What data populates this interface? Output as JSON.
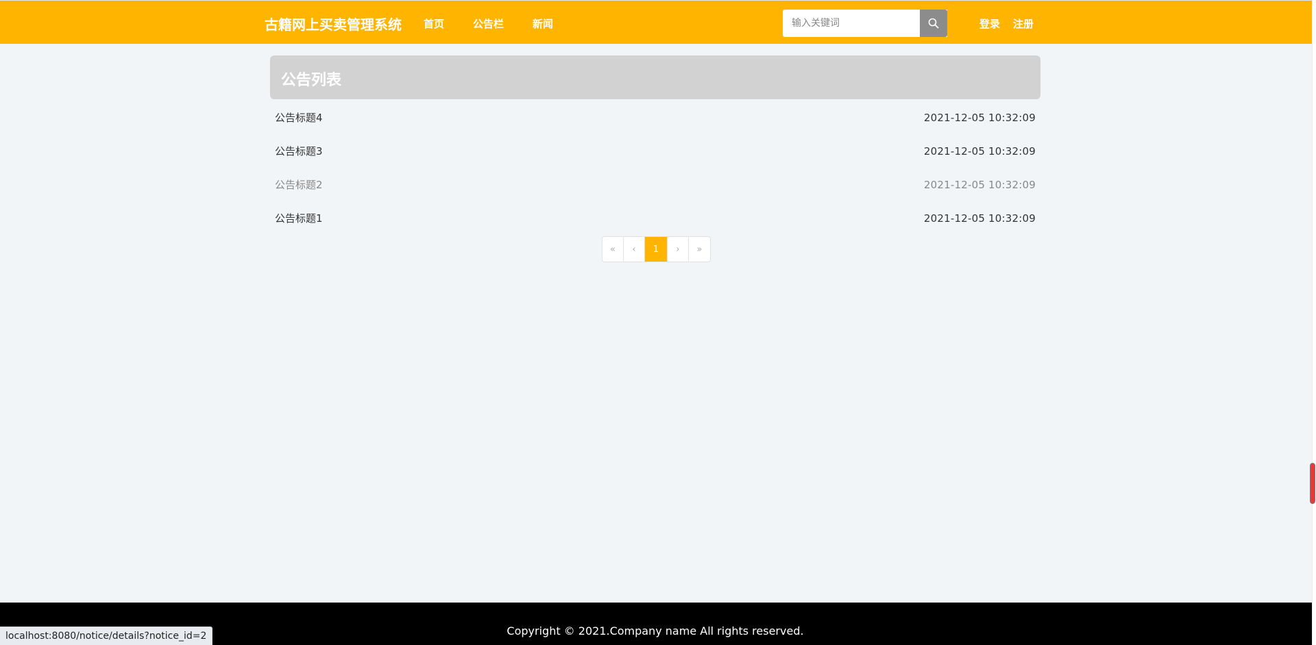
{
  "header": {
    "brand": "古籍网上买卖管理系统",
    "nav": [
      "首页",
      "公告栏",
      "新闻"
    ],
    "search_placeholder": "输入关键词",
    "login": "登录",
    "register": "注册"
  },
  "main": {
    "panel_title": "公告列表",
    "notices": [
      {
        "title": "公告标题4",
        "time": "2021-12-05 10:32:09"
      },
      {
        "title": "公告标题3",
        "time": "2021-12-05 10:32:09"
      },
      {
        "title": "公告标题2",
        "time": "2021-12-05 10:32:09"
      },
      {
        "title": "公告标题1",
        "time": "2021-12-05 10:32:09"
      }
    ],
    "pagination": {
      "first": "«",
      "prev": "‹",
      "current": "1",
      "next": "›",
      "last": "»"
    }
  },
  "footer": {
    "copyright": "Copyright © 2021.Company name All rights reserved."
  },
  "status_bar": {
    "url": "localhost:8080/notice/details?notice_id=2"
  },
  "colors": {
    "accent": "#ffb400",
    "footer_bg": "#000000",
    "page_bg": "#f2f5f8"
  }
}
